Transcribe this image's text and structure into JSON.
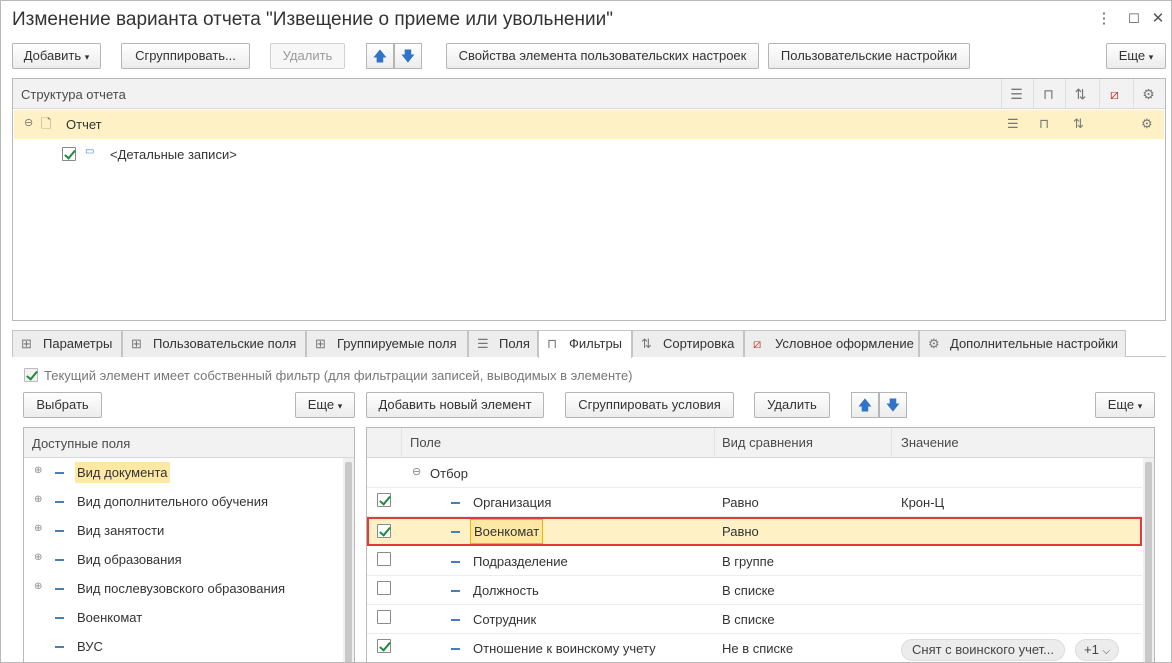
{
  "window": {
    "title": "Изменение варианта отчета \"Извещение о приеме или увольнении\"",
    "menu_icon": "⋮",
    "maximize_icon": "☐",
    "close_icon": "✕"
  },
  "toolbar": {
    "add": "Добавить",
    "group": "Сгруппировать...",
    "delete": "Удалить",
    "props": "Свойства элемента пользовательских настроек",
    "user_settings": "Пользовательские настройки",
    "more": "Еще"
  },
  "structure": {
    "header": "Структура отчета",
    "rows": [
      {
        "label": "Отчет"
      },
      {
        "label": "<Детальные записи>"
      }
    ]
  },
  "tabs": [
    {
      "label": "Параметры"
    },
    {
      "label": "Пользовательские поля"
    },
    {
      "label": "Группируемые поля"
    },
    {
      "label": "Поля"
    },
    {
      "label": "Фильтры"
    },
    {
      "label": "Сортировка"
    },
    {
      "label": "Условное оформление"
    },
    {
      "label": "Дополнительные настройки"
    }
  ],
  "filters": {
    "own_filter_label": "Текущий элемент имеет собственный фильтр (для фильтрации записей, выводимых в элементе)",
    "choose": "Выбрать",
    "more_left": "Еще",
    "add_new": "Добавить новый элемент",
    "group_conditions": "Сгруппировать условия",
    "delete": "Удалить",
    "more_right": "Еще",
    "available_header": "Доступные поля",
    "available": [
      {
        "label": "Вид документа"
      },
      {
        "label": "Вид дополнительного обучения"
      },
      {
        "label": "Вид занятости"
      },
      {
        "label": "Вид образования"
      },
      {
        "label": "Вид послевузовского образования"
      },
      {
        "label": "Военкомат"
      },
      {
        "label": "ВУС"
      }
    ],
    "columns": {
      "field": "Поле",
      "compare": "Вид сравнения",
      "value": "Значение"
    },
    "group_row": "Отбор",
    "rows": [
      {
        "field": "Организация",
        "compare": "Равно",
        "value": "Крон-Ц",
        "checked": true
      },
      {
        "field": "Военкомат",
        "compare": "Равно",
        "value": "",
        "checked": true
      },
      {
        "field": "Подразделение",
        "compare": "В группе",
        "value": "",
        "checked": false
      },
      {
        "field": "Должность",
        "compare": "В списке",
        "value": "",
        "checked": false
      },
      {
        "field": "Сотрудник",
        "compare": "В списке",
        "value": "",
        "checked": false
      },
      {
        "field": "Отношение к воинскому учету",
        "compare": "Не в списке",
        "value": "",
        "checked": true
      }
    ],
    "tag_value": "Снят с воинского учет...",
    "tag_more": "+1"
  },
  "colors": {
    "highlight": "#fdf1c5",
    "selection_border": "#e03a3e",
    "check": "#1e8a3a"
  }
}
